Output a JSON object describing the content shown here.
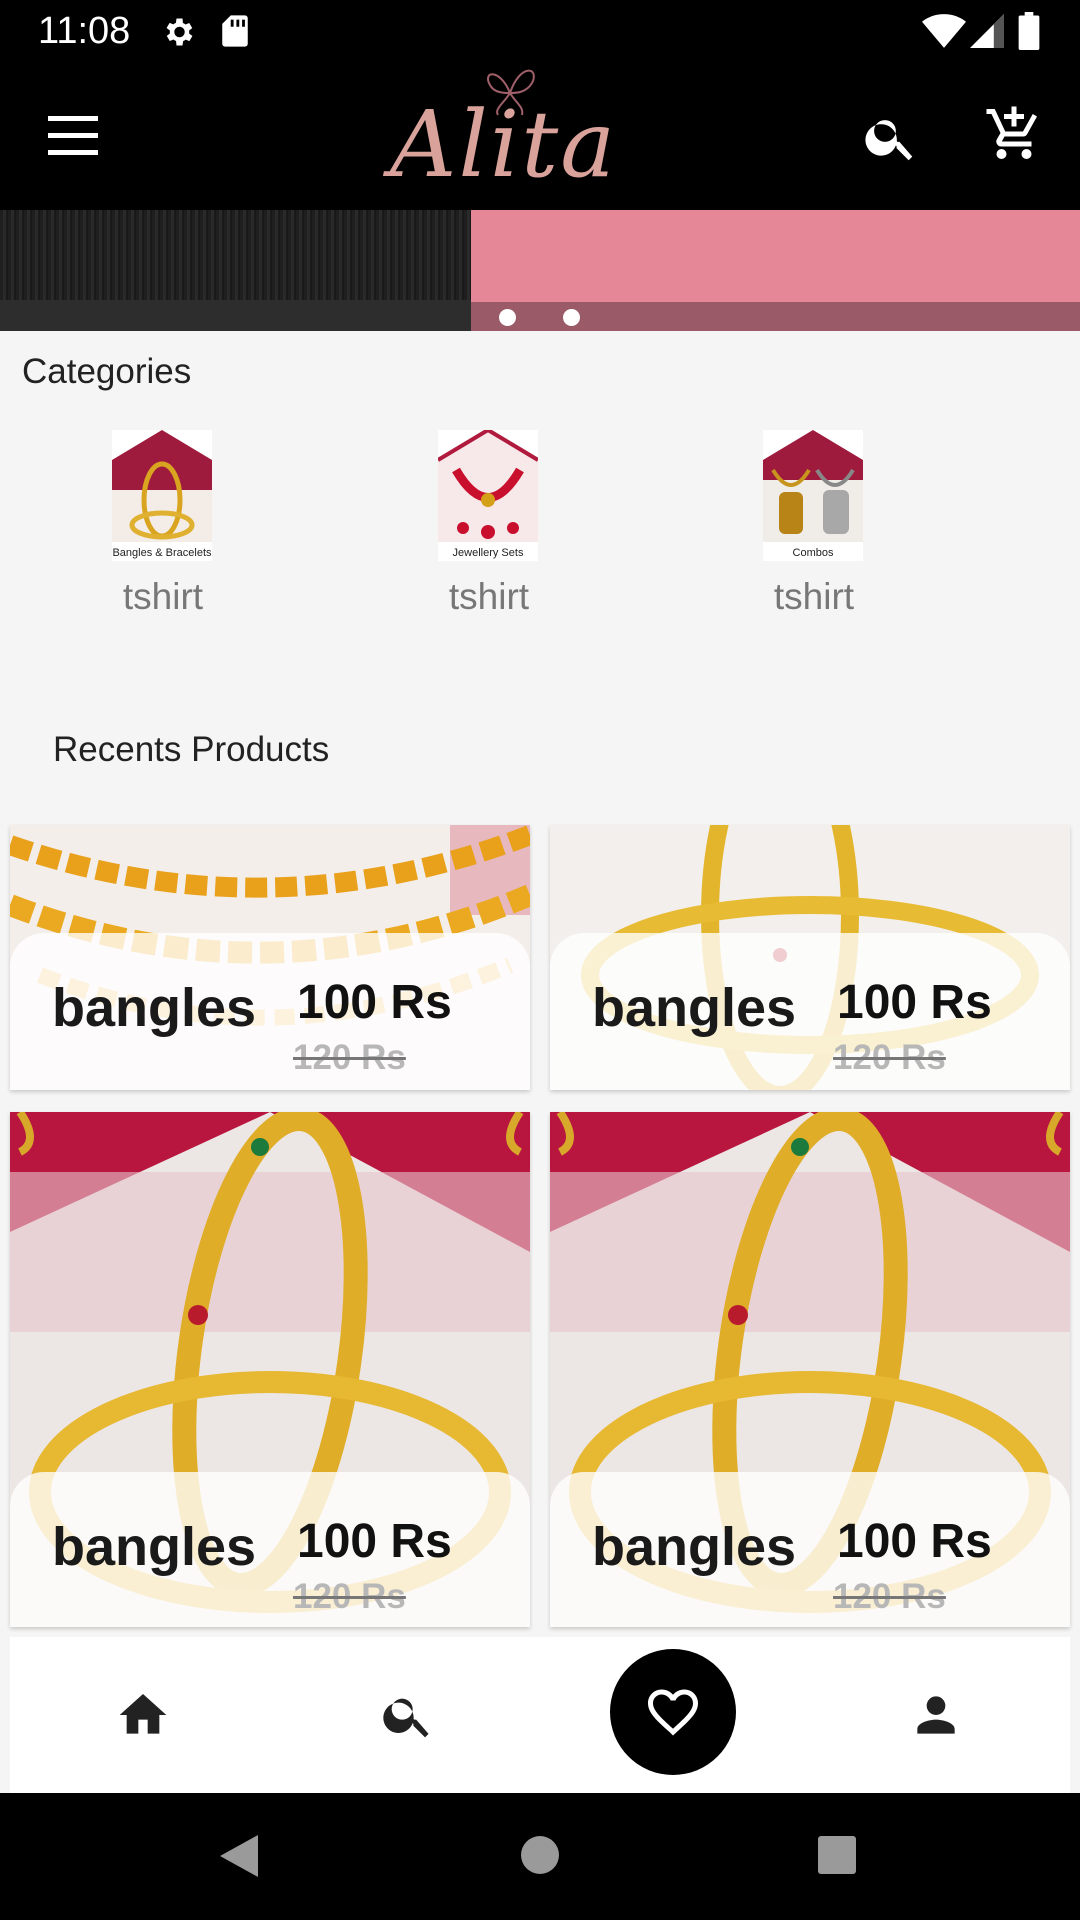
{
  "status_bar": {
    "time": "11:08",
    "icons": [
      "gear-icon",
      "sd-card-icon",
      "wifi-icon",
      "signal-icon",
      "battery-icon"
    ]
  },
  "app_bar": {
    "logo_text": "Alita",
    "icons": [
      "menu-icon",
      "search-icon",
      "add-to-cart-icon"
    ],
    "background": "#000000",
    "logo_color": "#d9a39b"
  },
  "banner": {
    "slides": 2,
    "accent": "#e58797"
  },
  "categories": {
    "title": "Categories",
    "items": [
      {
        "label": "tshirt",
        "caption": "Bangles & Bracelets"
      },
      {
        "label": "tshirt",
        "caption": "Jewellery Sets"
      },
      {
        "label": "tshirt",
        "caption": "Combos"
      }
    ]
  },
  "recent_products": {
    "title": "Recents Products",
    "items": [
      {
        "name": "bangles",
        "price": "100 Rs",
        "old_price": "120 Rs"
      },
      {
        "name": "bangles",
        "price": "100 Rs",
        "old_price": "120 Rs"
      },
      {
        "name": "bangles",
        "price": "100 Rs",
        "old_price": "120 Rs"
      },
      {
        "name": "bangles",
        "price": "100 Rs",
        "old_price": "120 Rs"
      }
    ]
  },
  "bottom_nav": {
    "items": [
      "home-icon",
      "search-icon",
      "heart-icon",
      "person-icon"
    ],
    "active": "heart-icon"
  },
  "system_nav": {
    "items": [
      "back-icon",
      "home-circle-icon",
      "recents-square-icon"
    ]
  }
}
